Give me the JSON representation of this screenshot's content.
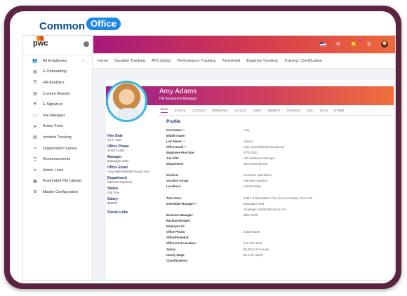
{
  "brand": {
    "word1": "Common",
    "word2": "Office"
  },
  "sidebar": {
    "logo": "pwc",
    "items": [
      {
        "icon": "users-icon",
        "glyph": "👥",
        "label": "All Employees",
        "chevron": true
      },
      {
        "icon": "onboarding-icon",
        "glyph": "▤",
        "label": "E-Onboarding"
      },
      {
        "icon": "analytics-icon",
        "glyph": "☰",
        "label": "HR Analytics"
      },
      {
        "icon": "report-icon",
        "glyph": "▥",
        "label": "Custom Reports"
      },
      {
        "icon": "signature-icon",
        "glyph": "⛨",
        "label": "E-Signature"
      },
      {
        "icon": "folder-icon",
        "glyph": "▭",
        "label": "File Manager"
      },
      {
        "icon": "action-icon",
        "glyph": "➤",
        "label": "Action Form"
      },
      {
        "icon": "incident-icon",
        "glyph": "▤",
        "label": "Incident Tracking"
      },
      {
        "icon": "survey-icon",
        "glyph": "∞",
        "label": "Organization Survey"
      },
      {
        "icon": "announcement-icon",
        "glyph": "☷",
        "label": "Announcements"
      },
      {
        "icon": "link-icon",
        "glyph": "⚭",
        "label": "Admin Links"
      },
      {
        "icon": "upload-icon",
        "glyph": "▦",
        "label": "Automated File Upload"
      },
      {
        "icon": "config-icon",
        "glyph": "⚙",
        "label": "Master Configuration"
      }
    ]
  },
  "topbar": {
    "notification_count": "12"
  },
  "tabs": [
    "Home",
    "Vacation Tracking",
    "ATS (Jobs)",
    "Performance Tracking",
    "Timesheet",
    "Expense Tracking",
    "Training / Certification"
  ],
  "employee": {
    "name": "Amy Adams",
    "title": "HR Assistance Manager",
    "subtabs": [
      "MAIN",
      "STATUS",
      "CONTACT",
      "PERSONAL",
      "ACCESS",
      "AUDIT",
      "BENEFIT",
      "TRAINING",
      "DOC",
      "PLAN",
      "OTHER"
    ],
    "left": {
      "hire_label": "Hire Date",
      "hire": "Jul 1, 2021",
      "phone_label": "Office Phone",
      "phone": "4185751459",
      "manager_label": "Manager",
      "manager": "ZManager SSM",
      "email_label": "Office Email",
      "email": "Amy.Adams@testhrcloud3.com",
      "dept_label": "Department",
      "dept": "Web Development",
      "status_label": "Status",
      "status": "Full Time",
      "salary_label": "Salary",
      "salary": "$66000",
      "social_label": "Social Links"
    },
    "profile_heading": "Profile",
    "fields": [
      {
        "k": "First Name * :",
        "v": "Amy"
      },
      {
        "k": "Middle Name:",
        "v": ""
      },
      {
        "k": "Last Name * :",
        "v": "Adams"
      },
      {
        "k": "Office Email * :",
        "v": "Amy.Adams@testhrcloud3.com"
      },
      {
        "k": "Employee Hire Date:",
        "v": "07/01/2021"
      },
      {
        "k": "Job Title:",
        "v": "HR Assistance Manager"
      },
      {
        "k": "Department:",
        "v": "Web Development"
      },
      {
        "k": "",
        "v": ""
      },
      {
        "k": "Division:",
        "v": "Customer Operations"
      },
      {
        "k": "Vacation Group:",
        "v": "Standard Vacation"
      },
      {
        "k": "Locations:",
        "v": "United States"
      },
      {
        "k": "",
        "v": ""
      },
      {
        "k": "Time Zone:",
        "v": "(GMT -5:00) Eastern Time (US & Canada), New York"
      },
      {
        "k": "Immediate Manager *:",
        "v": "ZManager SSM"
      },
      {
        "k": "",
        "v": "zmanager.ssm@testhrcloud.com"
      },
      {
        "k": "Business Manager:",
        "v": "Mike Smith"
      },
      {
        "k": "Backup Manager:",
        "v": ""
      },
      {
        "k": "Employee Id:",
        "v": ""
      },
      {
        "k": "Office Phone:",
        "v": "4185751459"
      },
      {
        "k": "OfficePhoneExt:",
        "v": ""
      },
      {
        "k": "Office Desk Location:",
        "v": "212-344-4343"
      },
      {
        "k": "Salary:",
        "v": "66,000 CAD Hourly"
      },
      {
        "k": "Hourly Wage:",
        "v": "33 CAD Hourly"
      },
      {
        "k": "Classifications:",
        "v": ""
      }
    ]
  }
}
